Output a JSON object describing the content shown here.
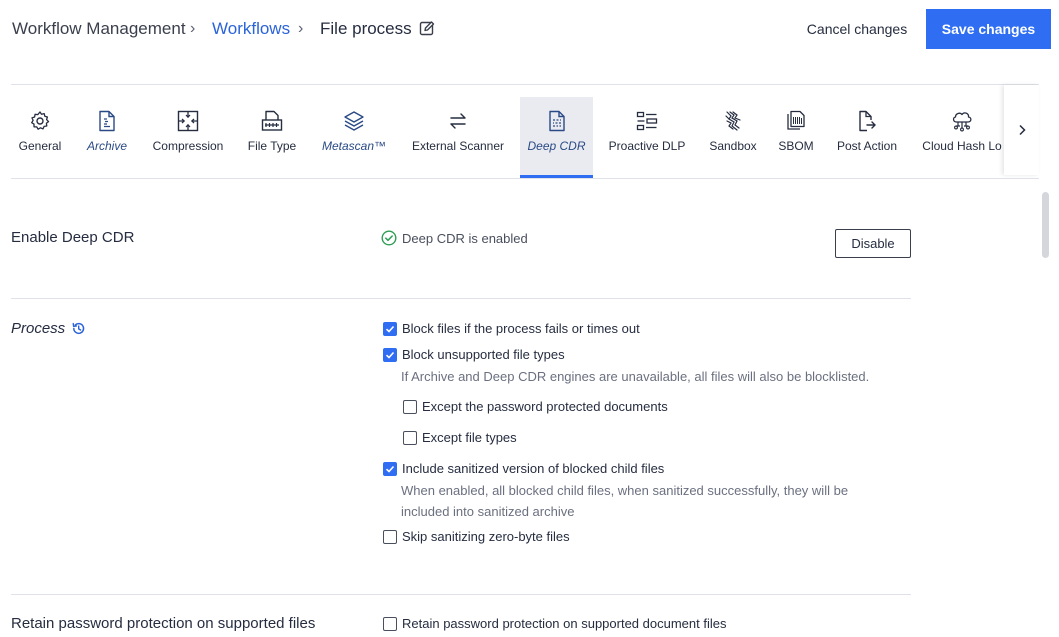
{
  "breadcrumb": {
    "root": "Workflow Management",
    "sep1": "›",
    "link": "Workflows",
    "sep2": "›",
    "current": "File process"
  },
  "actions": {
    "cancel": "Cancel changes",
    "save": "Save changes"
  },
  "tabs": [
    {
      "label": "General",
      "icon": "gear-icon"
    },
    {
      "label": "Archive",
      "icon": "archive-file-icon"
    },
    {
      "label": "Compression",
      "icon": "compression-icon"
    },
    {
      "label": "File Type",
      "icon": "file-type-icon"
    },
    {
      "label": "Metascan™",
      "icon": "layers-icon"
    },
    {
      "label": "External Scanner",
      "icon": "swap-arrows-icon"
    },
    {
      "label": "Deep CDR",
      "icon": "deep-cdr-icon"
    },
    {
      "label": "Proactive DLP",
      "icon": "dlp-icon"
    },
    {
      "label": "Sandbox",
      "icon": "sandbox-icon"
    },
    {
      "label": "SBOM",
      "icon": "sbom-icon"
    },
    {
      "label": "Post Action",
      "icon": "post-action-icon"
    },
    {
      "label": "Cloud Hash Lo",
      "icon": "cloud-hash-icon"
    }
  ],
  "active_tab": "Deep CDR",
  "enable_section": {
    "label": "Enable Deep CDR",
    "status": "Deep CDR is enabled",
    "button": "Disable"
  },
  "process_section": {
    "label": "Process",
    "options": [
      {
        "label": "Block files if the process fails or times out",
        "checked": true
      },
      {
        "label": "Block unsupported file types",
        "checked": true
      },
      {
        "label": "Except the password protected documents",
        "checked": false
      },
      {
        "label": "Except file types",
        "checked": false
      },
      {
        "label": "Include sanitized version of blocked child files",
        "checked": true
      },
      {
        "label": "Skip sanitizing zero-byte files",
        "checked": false
      }
    ],
    "help_unsupported": "If Archive and Deep CDR engines are unavailable, all files will also be blocklisted.",
    "help_child_line1": "When enabled, all blocked child files, when sanitized successfully, they will be",
    "help_child_line2": "included into sanitized archive"
  },
  "retain_section": {
    "label": "Retain password protection on supported files",
    "option": {
      "label": "Retain password protection on supported document files",
      "checked": false
    }
  },
  "colors": {
    "accent": "#2f6ef2",
    "link": "#2b63d9",
    "success": "#2e9e55"
  }
}
